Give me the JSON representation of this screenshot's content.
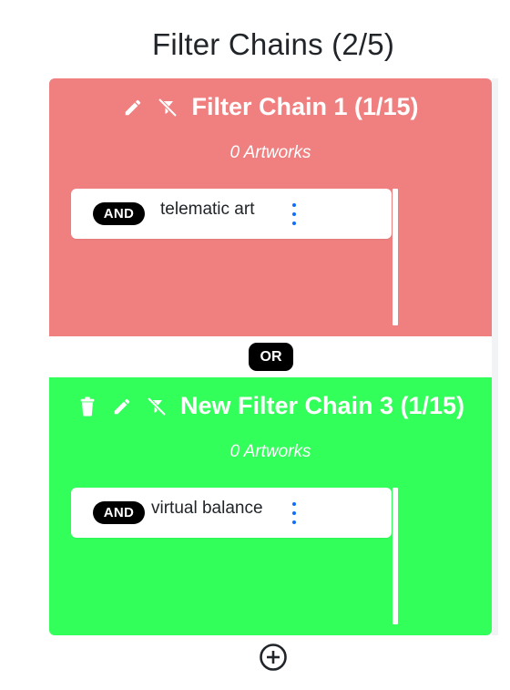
{
  "page": {
    "title": "Filter Chains (2/5)"
  },
  "chains": [
    {
      "title": "Filter Chain 1 (1/15)",
      "count_text": "0 Artworks",
      "color": "#f08080",
      "icons": [
        "pencil-icon",
        "filter-off-icon"
      ],
      "filters": [
        {
          "operator": "AND",
          "label": "telematic art"
        }
      ]
    },
    {
      "title": "New Filter Chain 3 (1/15)",
      "count_text": "0 Artworks",
      "color": "#33ff5b",
      "icons": [
        "trash-icon",
        "pencil-icon",
        "filter-off-icon"
      ],
      "filters": [
        {
          "operator": "AND",
          "label": "virtual balance"
        }
      ]
    }
  ],
  "connector": {
    "label": "OR"
  },
  "colors": {
    "badge_bg": "#000000",
    "kebab": "#0d6efd",
    "text": "#212529"
  },
  "add_button": {
    "icon": "plus-circle-icon"
  }
}
